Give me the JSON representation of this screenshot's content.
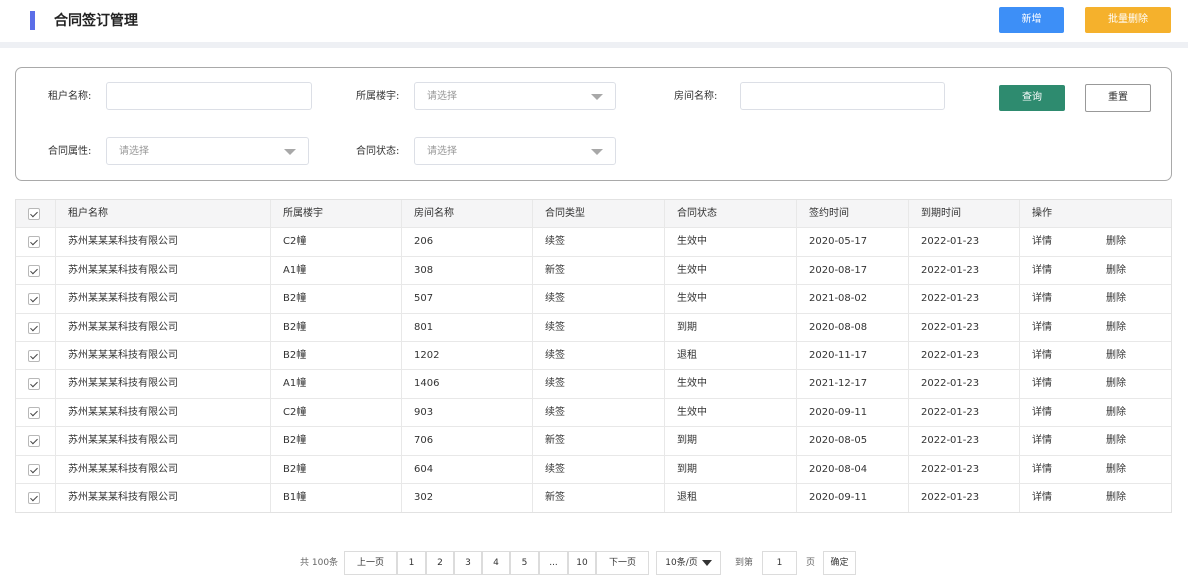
{
  "header": {
    "title": "合同签订管理",
    "add_label": "新增",
    "batch_delete_label": "批量删除",
    "accent": "#5b6ee8"
  },
  "filters": {
    "tenant_label": "租户名称:",
    "building_label": "所属楼宇:",
    "building_placeholder": "请选择",
    "room_label": "房间名称:",
    "contract_attr_label": "合同属性:",
    "contract_attr_placeholder": "请选择",
    "contract_status_label": "合同状态:",
    "contract_status_placeholder": "请选择",
    "query_label": "查询",
    "reset_label": "重置"
  },
  "table": {
    "headers": [
      "租户名称",
      "所属楼宇",
      "房间名称",
      "合同类型",
      "合同状态",
      "签约时间",
      "到期时间",
      "操作"
    ],
    "detail_label": "详情",
    "delete_label": "删除",
    "rows": [
      {
        "tenant": "苏州某某某科技有限公司",
        "building": "C2幢",
        "room": "206",
        "type": "续签",
        "status": "生效中",
        "sign": "2020-05-17",
        "expire": "2022-01-23"
      },
      {
        "tenant": "苏州某某某科技有限公司",
        "building": "A1幢",
        "room": "308",
        "type": "新签",
        "status": "生效中",
        "sign": "2020-08-17",
        "expire": "2022-01-23"
      },
      {
        "tenant": "苏州某某某科技有限公司",
        "building": "B2幢",
        "room": "507",
        "type": "续签",
        "status": "生效中",
        "sign": "2021-08-02",
        "expire": "2022-01-23"
      },
      {
        "tenant": "苏州某某某科技有限公司",
        "building": "B2幢",
        "room": "801",
        "type": "续签",
        "status": "到期",
        "sign": "2020-08-08",
        "expire": "2022-01-23"
      },
      {
        "tenant": "苏州某某某科技有限公司",
        "building": "B2幢",
        "room": "1202",
        "type": "续签",
        "status": "退租",
        "sign": "2020-11-17",
        "expire": "2022-01-23"
      },
      {
        "tenant": "苏州某某某科技有限公司",
        "building": "A1幢",
        "room": "1406",
        "type": "续签",
        "status": "生效中",
        "sign": "2021-12-17",
        "expire": "2022-01-23"
      },
      {
        "tenant": "苏州某某某科技有限公司",
        "building": "C2幢",
        "room": "903",
        "type": "续签",
        "status": "生效中",
        "sign": "2020-09-11",
        "expire": "2022-01-23"
      },
      {
        "tenant": "苏州某某某科技有限公司",
        "building": "B2幢",
        "room": "706",
        "type": "新签",
        "status": "到期",
        "sign": "2020-08-05",
        "expire": "2022-01-23"
      },
      {
        "tenant": "苏州某某某科技有限公司",
        "building": "B2幢",
        "room": "604",
        "type": "续签",
        "status": "到期",
        "sign": "2020-08-04",
        "expire": "2022-01-23"
      },
      {
        "tenant": "苏州某某某科技有限公司",
        "building": "B1幢",
        "room": "302",
        "type": "新签",
        "status": "退租",
        "sign": "2020-09-11",
        "expire": "2022-01-23"
      }
    ]
  },
  "pagination": {
    "total": "共 100条",
    "prev": "上一页",
    "pages": [
      "1",
      "2",
      "3",
      "4",
      "5",
      "...",
      "10"
    ],
    "next": "下一页",
    "page_size": "10条/页",
    "goto_prefix": "到第",
    "goto_value": "1",
    "goto_suffix": "页",
    "confirm": "确定"
  },
  "icons": {
    "checkbox": "checkbox-checked-icon",
    "caret": "caret-down-icon"
  }
}
